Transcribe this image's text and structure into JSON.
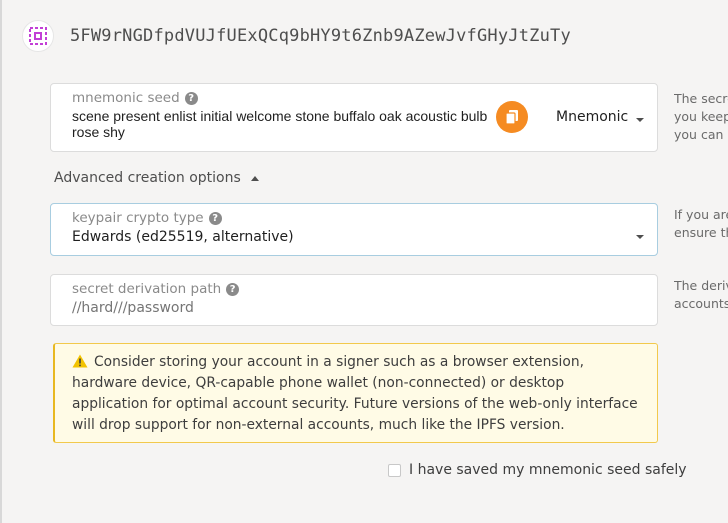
{
  "header": {
    "address": "5FW9rNGDfpdVUJfUExQCq9bHY9t6Znb9AZewJvfGHyJtZuTy"
  },
  "seed": {
    "label": "mnemonic seed",
    "value": "scene present enlist initial welcome stone buffalo oak acoustic bulb rose shy",
    "type_selected": "Mnemonic",
    "help_lines": [
      "The secre",
      "you keep",
      "you can r"
    ]
  },
  "advanced": {
    "toggle_label": "Advanced creation options"
  },
  "crypto": {
    "label": "keypair crypto type",
    "value": "Edwards (ed25519, alternative)",
    "help_lines": [
      "If you are",
      "ensure th"
    ]
  },
  "derivation": {
    "label": "secret derivation path",
    "placeholder": "//hard///password",
    "help_lines": [
      "The deriv",
      "accounts"
    ]
  },
  "warning": {
    "text": "Consider storing your account in a signer such as a browser extension, hardware device, QR-capable phone wallet (non-connected) or desktop application for optimal account security. Future versions of the web-only interface will drop support for non-external accounts, much like the IPFS version."
  },
  "confirm": {
    "label": "I have saved my mnemonic seed safely"
  },
  "colors": {
    "accent": "#f58b22",
    "identicon": "#c23fd6",
    "warning_bg": "#fffbe6",
    "warning_border": "#f2c94c"
  },
  "icons": [
    "identicon",
    "help-icon",
    "copy-icon",
    "chevron-down-icon",
    "chevron-up-icon",
    "warning-icon",
    "checkbox"
  ]
}
